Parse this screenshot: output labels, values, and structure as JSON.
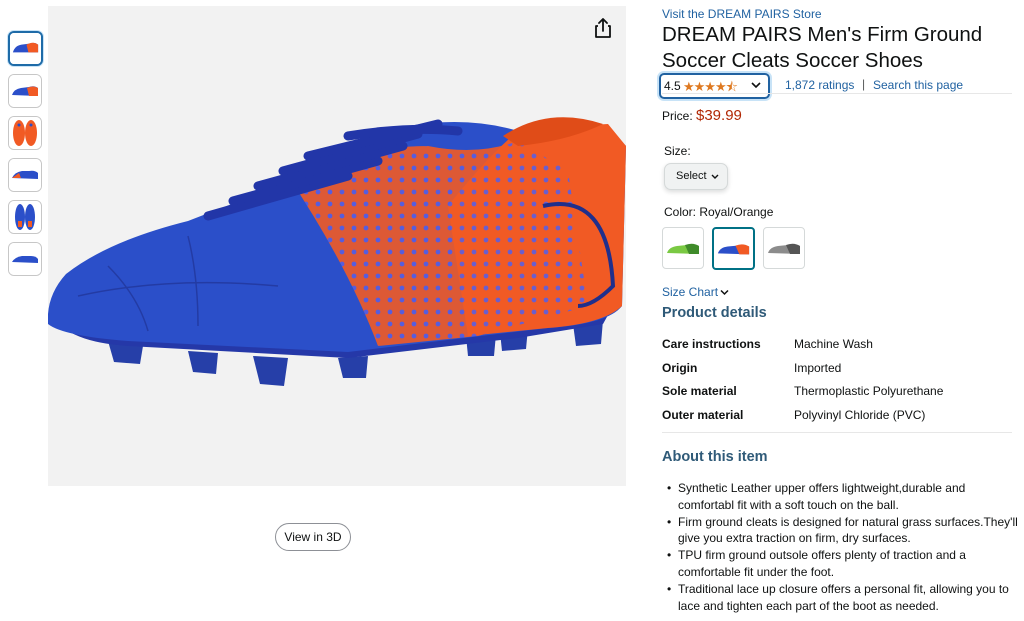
{
  "gallery": {
    "thumbnails": [
      {
        "alt": "Royal/Orange side view"
      },
      {
        "alt": "Royal/Orange outer view"
      },
      {
        "alt": "Sole view"
      },
      {
        "alt": "Inner view"
      },
      {
        "alt": "Top view"
      },
      {
        "alt": "Back view"
      }
    ],
    "share_icon": "share-icon",
    "view_3d_label": "View in 3D",
    "colors": {
      "blue": "#2b4fc9",
      "orange": "#f15a24",
      "bg": "#f2f2f2"
    }
  },
  "product": {
    "store_link": "Visit the DREAM PAIRS Store",
    "title": "DREAM PAIRS Men's Firm Ground Soccer Cleats Soccer Shoes",
    "rating": "4.5",
    "stars": "★★★★⯪",
    "ratings_count": "1,872 ratings",
    "separator": "|",
    "search_page": "Search this page",
    "price_label": "Price:",
    "price": "$39.99",
    "size_label": "Size:",
    "size_select": "Select",
    "color_label": "Color: Royal/Orange",
    "color_swatches": [
      "Green",
      "Royal/Orange",
      "Grey"
    ],
    "size_chart": "Size Chart"
  },
  "details": {
    "heading": "Product details",
    "rows": [
      {
        "key": "Care instructions",
        "value": "Machine Wash"
      },
      {
        "key": "Origin",
        "value": "Imported"
      },
      {
        "key": "Sole material",
        "value": "Thermoplastic Polyurethane"
      },
      {
        "key": "Outer material",
        "value": "Polyvinyl Chloride (PVC)"
      }
    ]
  },
  "about": {
    "heading": "About this item",
    "bullets": [
      "Synthetic Leather upper offers lightweight,durable and comfortabl fit with a soft touch on the ball.",
      "Firm ground cleats is designed for natural grass surfaces.They'll give you extra traction on firm, dry surfaces.",
      "TPU firm ground outsole offers plenty of traction and a comfortable fit under the foot.",
      "Traditional lace up closure offers a personal fit, allowing you to lace and tighten each part of the boot as needed."
    ]
  }
}
